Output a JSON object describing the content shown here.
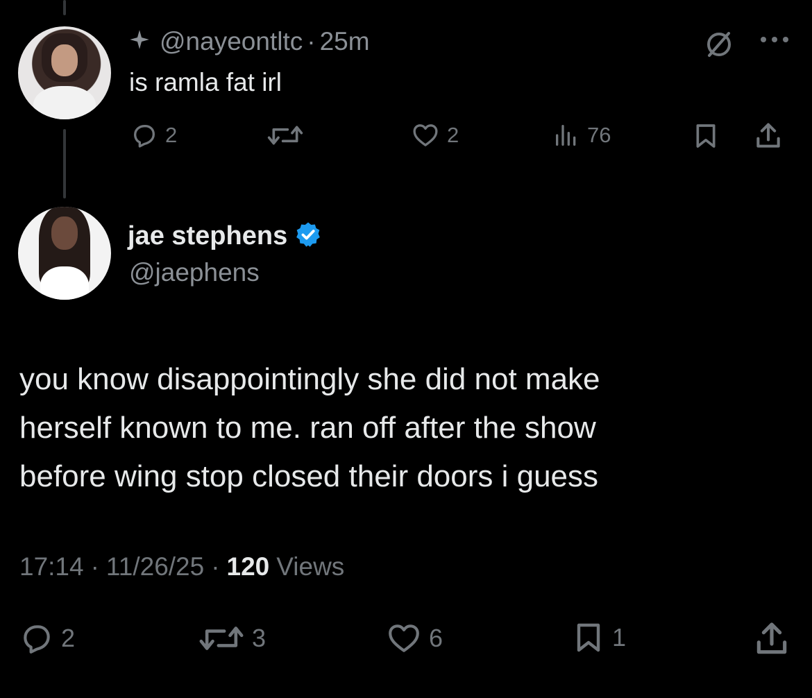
{
  "reply_to": {
    "handle": "@nayeontltc",
    "sep": "·",
    "time": "25m",
    "text": "is ramla fat irl",
    "stats": {
      "replies": "2",
      "likes": "2",
      "views": "76"
    }
  },
  "main": {
    "display_name": "jae stephens",
    "handle": "@jaephens",
    "text_lines": [
      "you know disappointingly she did not make",
      "herself known to me. ran off after the show",
      "before wing stop closed their doors i guess"
    ],
    "time": "17:14",
    "date": "11/26/25",
    "sep": "·",
    "views_count": "120",
    "views_label": "Views",
    "stats": {
      "replies": "2",
      "retweets": "3",
      "likes": "6",
      "bookmarks": "1"
    }
  },
  "colors": {
    "background": "#000000",
    "text": "#e7e9ea",
    "muted": "#71767b",
    "verified": "#1d9bf0"
  },
  "icons": [
    "sparkle-icon",
    "not-interested-icon",
    "more-icon",
    "reply-icon",
    "retweet-icon",
    "like-icon",
    "views-icon",
    "bookmark-icon",
    "share-icon",
    "verified-badge-icon"
  ]
}
